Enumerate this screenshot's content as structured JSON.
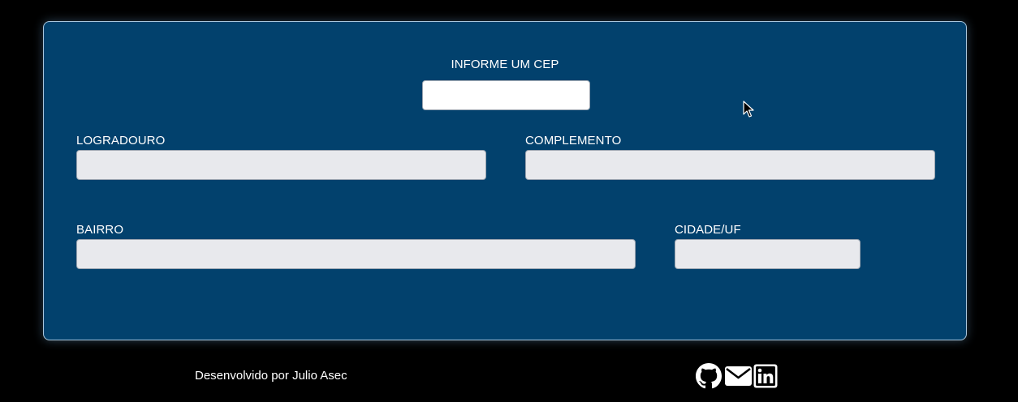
{
  "form": {
    "cep_label": "INFORME UM CEP",
    "cep_value": "",
    "logradouro_label": "LOGRADOURO",
    "logradouro_value": "",
    "complemento_label": "COMPLEMENTO",
    "complemento_value": "",
    "bairro_label": "BAIRRO",
    "bairro_value": "",
    "cidade_label": "CIDADE/UF",
    "cidade_value": ""
  },
  "footer": {
    "credit": "Desenvolvido por Julio Asec",
    "icons": [
      "github-icon",
      "mail-icon",
      "linkedin-icon"
    ]
  },
  "colors": {
    "page_background": "#000000",
    "card_background": "#02416d",
    "card_border": "#a9c6dc",
    "readonly_field": "#e8e9ed",
    "text": "#ffffff"
  }
}
